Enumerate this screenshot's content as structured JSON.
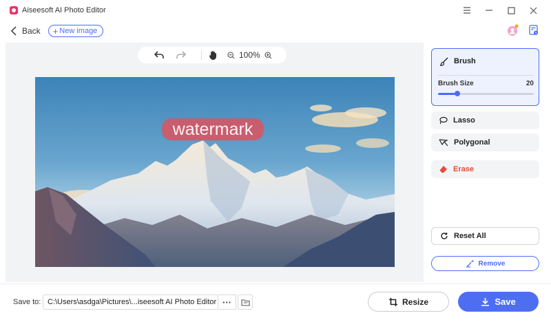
{
  "window": {
    "title": "Aiseesoft AI Photo Editor"
  },
  "header": {
    "back_label": "Back",
    "new_image_label": "New image"
  },
  "toolbar": {
    "zoom": "100%"
  },
  "canvas": {
    "watermark_text": "watermark"
  },
  "panel": {
    "brush_label": "Brush",
    "brush_size_label": "Brush Size",
    "brush_size_value": "20",
    "brush_size_fraction": 0.2,
    "lasso_label": "Lasso",
    "polygonal_label": "Polygonal",
    "erase_label": "Erase",
    "reset_label": "Reset All",
    "remove_label": "Remove"
  },
  "footer": {
    "save_to_label": "Save to:",
    "path_value": "C:\\Users\\asdga\\Pictures\\...iseesoft AI Photo Editor",
    "more_label": "···",
    "resize_label": "Resize",
    "save_label": "Save"
  },
  "colors": {
    "accent": "#4a6cf7",
    "erase": "#e84b3c",
    "brand": "#e8336b"
  }
}
